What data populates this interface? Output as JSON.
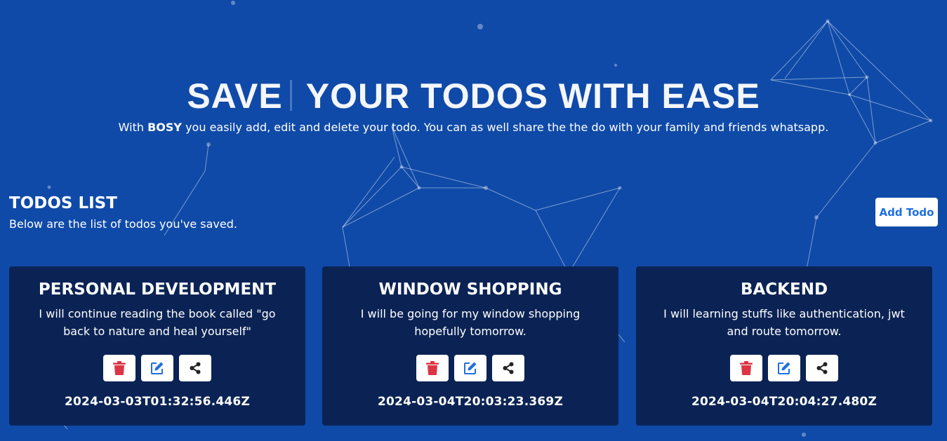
{
  "hero": {
    "title_word1": "SAVE",
    "title_rest": "YOUR TODOS WITH EASE",
    "subtitle_pre": "With ",
    "subtitle_brand": "BOSY",
    "subtitle_post": " you easily add, edit and delete your todo. You can as well share the the do with your family and friends whatsapp."
  },
  "list": {
    "title": "TODOS LIST",
    "description": "Below are the list of todos you've saved.",
    "add_label": "Add Todo"
  },
  "todos": [
    {
      "title": "PERSONAL DEVELOPMENT",
      "body": "I will continue reading the book called \"go back to nature and heal yourself\"",
      "timestamp": "2024-03-03T01:32:56.446Z"
    },
    {
      "title": "WINDOW SHOPPING",
      "body": "I will be going for my window shopping hopefully tomorrow.",
      "timestamp": "2024-03-04T20:03:23.369Z"
    },
    {
      "title": "BACKEND",
      "body": "I will learning stuffs like authentication, jwt and route tomorrow.",
      "timestamp": "2024-03-04T20:04:27.480Z"
    }
  ],
  "icons": {
    "delete": "trash-icon",
    "edit": "edit-icon",
    "share": "share-icon"
  },
  "colors": {
    "background": "#0f4aa8",
    "card": "#0b2354",
    "delete": "#dc3545",
    "edit": "#1f6fe0",
    "share": "#222222"
  }
}
